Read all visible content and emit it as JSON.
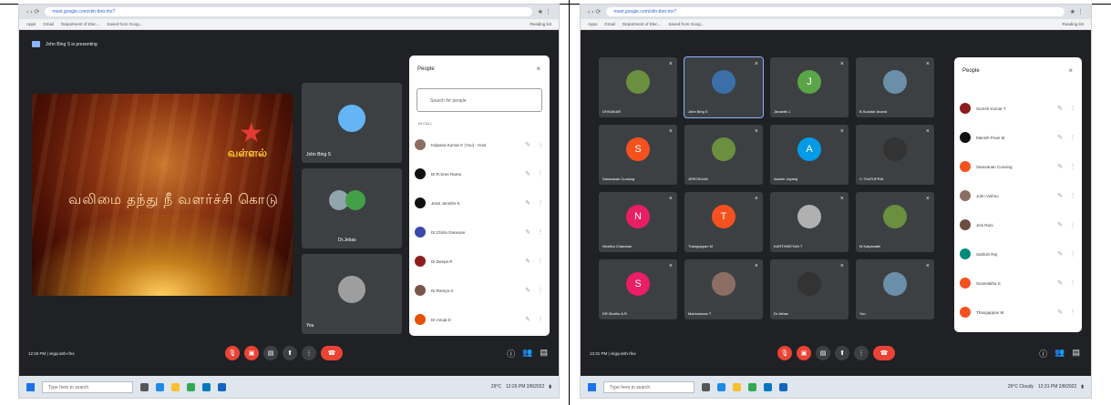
{
  "left": {
    "url": "meet.google.com/vkh-tbnt-rhx?",
    "bookmarks": [
      "Apps",
      "Gmail",
      "Department of Elec...",
      "Saved from Goog..."
    ],
    "reading_list": "Reading list",
    "presenter_label": "John Bing S is presenting",
    "slide": {
      "logo": "வள்ளல்",
      "slogan": "வலிமை தந்து நீ வளர்ச்சி கொடு"
    },
    "tiles": [
      {
        "name": "John Bing S"
      },
      {
        "name": "Dr.Jebas"
      },
      {
        "name": "You"
      }
    ],
    "people": {
      "title": "People",
      "close": "×",
      "search_placeholder": "Search for people",
      "section": "IN CALL",
      "rows": [
        {
          "name": "Kalpana Kumar K (You) - Host",
          "color": "#8d6e63"
        },
        {
          "name": "Dr.R.Sree Rama",
          "color": "#111111"
        },
        {
          "name": "Jessi Jennifer K",
          "color": "#111111"
        },
        {
          "name": "Dr.Chitra Ganesan",
          "color": "#3949ab"
        },
        {
          "name": "Dr.Deepa R",
          "color": "#8d1c1c"
        },
        {
          "name": "Dr.Ramya S",
          "color": "#795548"
        },
        {
          "name": "Dr.Anuja D",
          "color": "#e65100"
        }
      ]
    },
    "time": "12:26 PM",
    "meeting_code": "vkgq-atrb-rfex",
    "taskbar": {
      "search": "Type here to search",
      "weather": "29°C",
      "clock": "12:26 PM\n2/8/2022"
    }
  },
  "right": {
    "url": "meet.google.com/vkh-tbnt-rhx?",
    "bookmarks": [
      "Apps",
      "Gmail",
      "Department of Elec...",
      "Saved from Goog..."
    ],
    "reading_list": "Reading list",
    "grid": [
      {
        "name": "DHIVAKAR",
        "letter": "",
        "color": "#6a8f3f"
      },
      {
        "name": "John Bing S",
        "letter": "",
        "color": "#3b6fa8"
      },
      {
        "name": "Jananthi J",
        "letter": "J",
        "color": "#5aa548"
      },
      {
        "name": "B.Sunidar Anand",
        "letter": "",
        "color": "#6b8fa8"
      },
      {
        "name": "Saravanan Cunsing",
        "letter": "S",
        "color": "#f4511e"
      },
      {
        "name": "JEROSHAN",
        "letter": "",
        "color": "#6a8f3f"
      },
      {
        "name": "Aashin Jayaraj",
        "letter": "A",
        "color": "#039be5"
      },
      {
        "name": "C.THATUPRIA",
        "letter": "",
        "color": "#333333"
      },
      {
        "name": "Nivetha Chandran",
        "letter": "N",
        "color": "#e91e63"
      },
      {
        "name": "Thangappan M",
        "letter": "T",
        "color": "#f4511e"
      },
      {
        "name": "KARTHIKEYAN T",
        "letter": "",
        "color": "#b0b0b0"
      },
      {
        "name": "M.Kalyanathi",
        "letter": "",
        "color": "#6a8f3f"
      },
      {
        "name": "DR.Sindhu A.R",
        "letter": "S",
        "color": "#e91e63"
      },
      {
        "name": "Manivannan T",
        "letter": "",
        "color": "#8d6e63"
      },
      {
        "name": "Dr.Jebas",
        "letter": "",
        "color": "#333333"
      },
      {
        "name": "You",
        "letter": "",
        "color": "#6b8fa8"
      }
    ],
    "people": {
      "title": "People",
      "close": "×",
      "rows": [
        {
          "name": "Suresh Kumar T",
          "color": "#8d1c1c"
        },
        {
          "name": "Manish Prani M",
          "color": "#111111"
        },
        {
          "name": "Saravanan Cunsing",
          "color": "#f4511e"
        },
        {
          "name": "John Vishnu",
          "color": "#8d6e63"
        },
        {
          "name": "Jesi Rani",
          "color": "#6d4c41"
        },
        {
          "name": "Sathish Raj",
          "color": "#00897b"
        },
        {
          "name": "Suseelatha S",
          "color": "#f4511e"
        },
        {
          "name": "Thangappan M",
          "color": "#f4511e"
        }
      ]
    },
    "time": "12:31 PM",
    "meeting_code": "vkgq-atrb-rfex",
    "taskbar": {
      "search": "Type here to search",
      "weather": "29°C Cloudy",
      "clock": "12:31 PM\n2/8/2022"
    }
  }
}
